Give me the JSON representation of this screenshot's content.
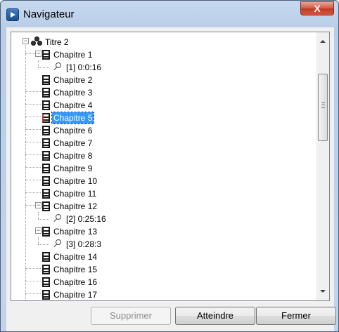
{
  "window": {
    "title": "Navigateur",
    "close_glyph": "X"
  },
  "tree": {
    "root": "Titre 2",
    "items": [
      "Chapitre 1",
      "[1]  0:0:16",
      "Chapitre 2",
      "Chapitre 3",
      "Chapitre 4",
      "Chapitre 5",
      "Chapitre 6",
      "Chapitre 7",
      "Chapitre 8",
      "Chapitre 9",
      "Chapitre 10",
      "Chapitre 11",
      "Chapitre 12",
      "[2]  0:25:16",
      "Chapitre 13",
      "[3]  0:28:3",
      "Chapitre 14",
      "Chapitre 15",
      "Chapitre 16",
      "Chapitre 17"
    ],
    "selected": "Chapitre 5"
  },
  "buttons": {
    "supprimer": "Supprimer",
    "atteindre": "Atteindre",
    "fermer": "Fermer"
  },
  "colors": {
    "selection": "#3399ff",
    "close": "#c23b22"
  }
}
